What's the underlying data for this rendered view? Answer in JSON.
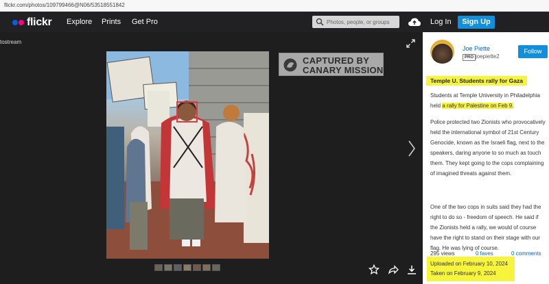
{
  "browser": {
    "url": "flickr.com/photos/109799466@N06/53518551842"
  },
  "header": {
    "logo": "flickr",
    "nav": [
      "Explore",
      "Prints",
      "Get Pro"
    ],
    "search_placeholder": "Photos, people, or groups",
    "login": "Log In",
    "signup": "Sign Up"
  },
  "viewer": {
    "photostream_label": "tostream",
    "watermark": {
      "line1": "CAPTURED BY",
      "line2": "CANARY MISSION"
    },
    "thumb_count": 7,
    "actions": [
      "star-icon",
      "share-icon",
      "download-icon"
    ]
  },
  "owner": {
    "name": "Joe Piette",
    "pro_badge": "PRO",
    "handle": "joepiette2",
    "follow": "Follow"
  },
  "photo": {
    "title": "Temple U. Students rally for Gaza",
    "para1_prefix": "Students at Temple University in Philadelphia held",
    "para1_highlight": "a rally for Palestine on Feb 9.",
    "para2": "Police protected two Zionists who provocatively held the international symbol of 21st Century Genocide, known as the Israeli flag, next to the speakers, daring anyone to so much as touch them. They kept going to the cops complaining of imagined threats against them.",
    "para3": "One of the two cops in suits said they had the right to do so - freedom of speech. He said if the Zionists held a rally, we would of course have the right to stand on their stage with our flag. He was lying of course."
  },
  "stats": {
    "views": "295 views",
    "faves": "0 faves",
    "comments": "0 comments"
  },
  "dates": {
    "uploaded": "Uploaded on February 10, 2024",
    "taken": "Taken on February 9, 2024"
  },
  "colors": {
    "nav_bg": "#212124",
    "viewer_bg": "#1e1e1e",
    "accent": "#128fdc",
    "link": "#0063dc",
    "highlight": "#f7f43c"
  }
}
